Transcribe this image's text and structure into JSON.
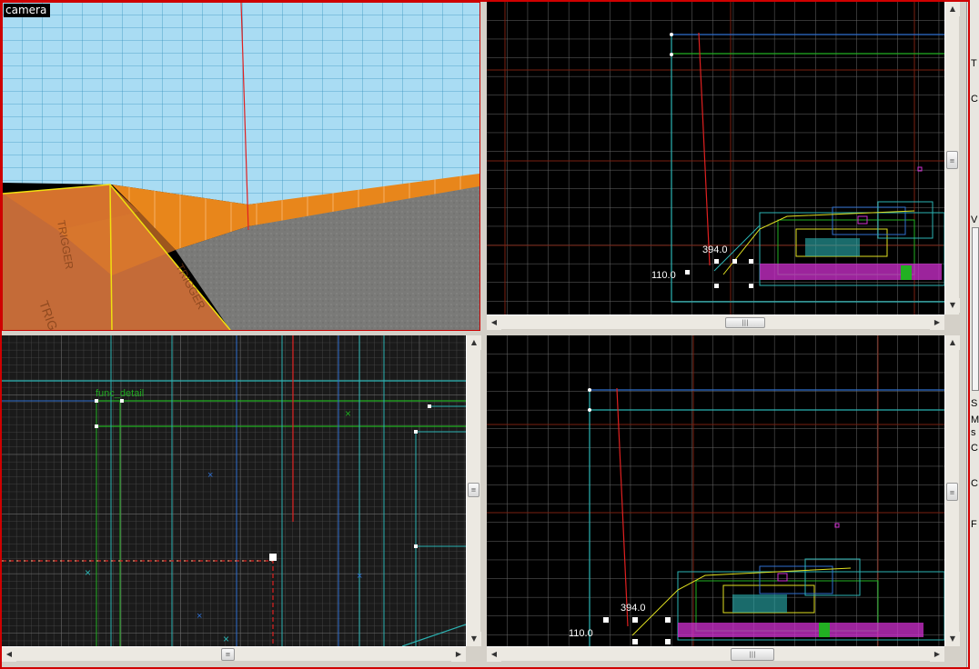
{
  "viewports": {
    "camera": {
      "label": "camera"
    },
    "top_right": {
      "dim_vertical": "394.0",
      "dim_horizontal": "110.0"
    },
    "bottom_left": {
      "entity_label": "func_detail"
    },
    "bottom_right": {
      "dim_vertical": "394.0",
      "dim_horizontal": "110.0"
    }
  },
  "scrollbar": {
    "up_glyph": "▲",
    "down_glyph": "▼",
    "left_glyph": "◀",
    "right_glyph": "▶",
    "thumb_grip": "|||"
  },
  "side_panel": {
    "glyphs": [
      "T",
      "C",
      "V",
      "S",
      "M",
      "s",
      "C",
      "C",
      "F"
    ]
  },
  "colors": {
    "grid_minor": "#3a3a3a",
    "grid_major": "#707070",
    "grid_origin": "#7a2010",
    "brush_cyan": "#2bb3b3",
    "brush_green": "#22b022",
    "brush_magenta": "#d030d0",
    "selection_red": "#e02020",
    "frame_red": "#d00000"
  }
}
